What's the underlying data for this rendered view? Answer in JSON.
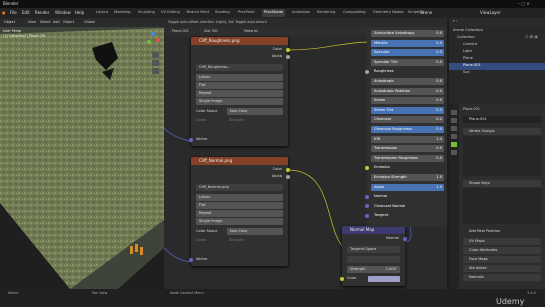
{
  "app": {
    "title": "Blender",
    "title_bar_text": "Toggle auto-offset direction (right), Alt: Toggle auto-attach"
  },
  "menus": [
    "File",
    "Edit",
    "Render",
    "Window",
    "Help"
  ],
  "workspaces": [
    "Layout",
    "Modeling",
    "Sculpting",
    "UV Editing",
    "Texture Paint",
    "Shading",
    "ProcPaint",
    "ProcShade",
    "Animation",
    "Rendering",
    "Compositing",
    "Geometry Nodes",
    "Scripting"
  ],
  "active_workspace": "ProcShade",
  "scene_name": "Scene",
  "view_layer": "ViewLayer",
  "viewport": {
    "mode": "Object",
    "view_label": "User Persp",
    "collection_label": "(1) Collection | Plane.001",
    "menu": [
      "View",
      "Select",
      "Add",
      "Object"
    ],
    "shading_label": "Global"
  },
  "node_editor": {
    "object": "Plane.001",
    "slot": "Slot 001",
    "material": "Material",
    "nodes": [
      {
        "title": "Cliff_Roughness.png",
        "image": "Cliff_Roughness...",
        "interpolation": "Linear",
        "projection": "Flat",
        "extension": "Repeat",
        "source": "Single Image",
        "color_space_label": "Color Space",
        "color_space": "Non-Color",
        "alpha_label": "Alpha",
        "alpha": "Straight",
        "out1": "Color",
        "out2": "Alpha",
        "input": "Vector"
      },
      {
        "title": "Cliff_Normal.png",
        "image": "Cliff_Normal.png",
        "interpolation": "Linear",
        "projection": "Flat",
        "extension": "Repeat",
        "source": "Single Image",
        "color_space_label": "Color Space",
        "color_space": "Non-Color",
        "alpha_label": "Alpha",
        "alpha": "Straight",
        "out1": "Color",
        "out2": "Alpha",
        "input": "Vector"
      }
    ],
    "normal_map": {
      "title": "Normal Map",
      "output": "Normal",
      "space": "Tangent Space",
      "strength_label": "Strength",
      "strength": "1.000",
      "color_label": "Color"
    },
    "bsdf_rows": [
      {
        "label": "Subsurface Anisotropy",
        "value": "0.0",
        "hl": false
      },
      {
        "label": "Metallic",
        "value": "0.0",
        "hl": true
      },
      {
        "label": "Specular",
        "value": "0.5",
        "hl": true
      },
      {
        "label": "Specular Tint",
        "value": "0.0",
        "hl": false
      },
      {
        "label": "Roughness",
        "value": "",
        "hl": false
      },
      {
        "label": "Anisotropic",
        "value": "0.0",
        "hl": false
      },
      {
        "label": "Anisotropic Rotation",
        "value": "0.0",
        "hl": false
      },
      {
        "label": "Sheen",
        "value": "0.0",
        "hl": false
      },
      {
        "label": "Sheen Tint",
        "value": "0.5",
        "hl": true
      },
      {
        "label": "Clearcoat",
        "value": "0.0",
        "hl": false
      },
      {
        "label": "Clearcoat Roughness",
        "value": "0.0",
        "hl": true
      },
      {
        "label": "IOR",
        "value": "1.4",
        "hl": false
      },
      {
        "label": "Transmission",
        "value": "0.0",
        "hl": false
      },
      {
        "label": "Transmission Roughness",
        "value": "0.0",
        "hl": false
      },
      {
        "label": "Emission",
        "value": "",
        "hl": false
      },
      {
        "label": "Emission Strength",
        "value": "1.0",
        "hl": false
      },
      {
        "label": "Alpha",
        "value": "1.0",
        "hl": true
      },
      {
        "label": "Normal",
        "value": "",
        "hl": false
      },
      {
        "label": "Clearcoat Normal",
        "value": "",
        "hl": false
      },
      {
        "label": "Tangent",
        "value": "",
        "hl": false
      }
    ]
  },
  "outliner": {
    "header": "Scene Collection",
    "rows": [
      "Collection",
      "Camera",
      "Light",
      "Plane",
      "Plane.001",
      "Sun"
    ]
  },
  "properties": {
    "object": "Plane.001",
    "mesh": "Plane.001",
    "sections": [
      "Vertex Groups",
      "Shape Keys",
      "Add Rest Position",
      "UV Maps",
      "Color Attributes",
      "Face Maps",
      "Attributes",
      "Normals"
    ]
  },
  "status": {
    "left": "Select",
    "middle": "Pan View",
    "right": "Node Context Menu",
    "version": "3.4.0",
    "watermark": "Udemy"
  },
  "colors": {
    "image_header": "#834226",
    "normal_header": "#3c3a70",
    "socket_yellow": "#c7c729",
    "socket_purple": "#6363c7",
    "socket_grey": "#a1a1a1",
    "bsdf_blue": "#4772b3",
    "wire": "#7a7a7a"
  }
}
